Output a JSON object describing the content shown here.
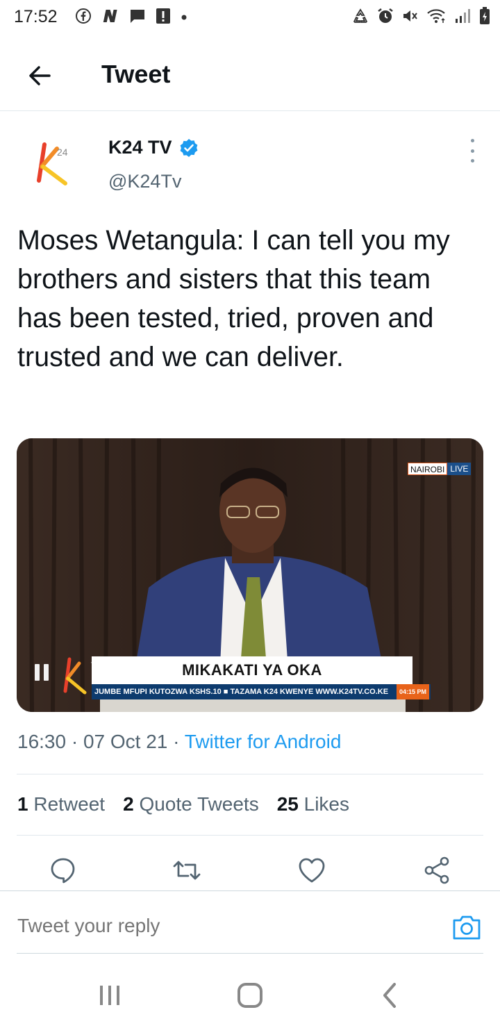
{
  "status_bar": {
    "time": "17:52",
    "left_icons": [
      "facebook-icon",
      "news-icon",
      "chat-icon",
      "alert-icon",
      "dot-icon"
    ],
    "right_icons": [
      "recycle-icon",
      "alarm-icon",
      "mute-icon",
      "wifi-icon",
      "signal-icon",
      "battery-icon"
    ]
  },
  "app_bar": {
    "title": "Tweet"
  },
  "tweet": {
    "author_name": "K24 TV",
    "author_handle": "@K24Tv",
    "verified": true,
    "text": "Moses Wetangula: I can tell you my brothers and sisters that this team has been tested, tried, proven and trusted and we can deliver.",
    "media": {
      "live_location": "NAIROBI",
      "live_label": "LIVE",
      "headline": "MIKAKATI YA OKA",
      "ticker": "JUMBE MFUPI KUTOZWA KSHS.10  ■  TAZAMA K24 KWENYE WWW.K24TV.CO.KE",
      "ticker_time": "04:15 PM",
      "playing_state": "paused"
    },
    "time": "16:30",
    "date": "07 Oct 21",
    "source": "Twitter for Android",
    "stats": {
      "retweets_count": "1",
      "retweets_label": "Retweet",
      "quotes_count": "2",
      "quotes_label": "Quote Tweets",
      "likes_count": "25",
      "likes_label": "Likes"
    }
  },
  "actions": [
    "reply-icon",
    "retweet-icon",
    "like-icon",
    "share-icon"
  ],
  "reply_bar": {
    "placeholder": "Tweet your reply"
  },
  "colors": {
    "accent": "#1d9bf0",
    "text_primary": "#0f1419",
    "text_secondary": "#536471",
    "divider": "#e1e8ed"
  }
}
